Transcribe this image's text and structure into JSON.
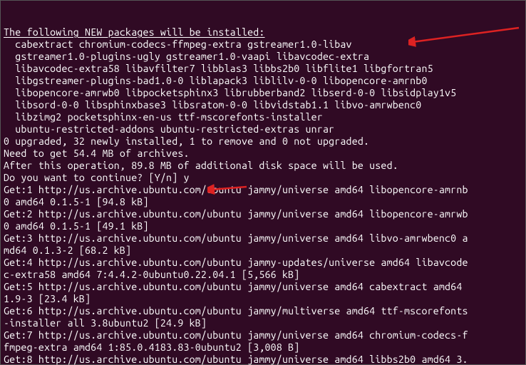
{
  "header": "The following NEW packages will be installed:",
  "packages_indent": "  ",
  "package_lines": [
    "cabextract chromium-codecs-ffmpeg-extra gstreamer1.0-libav",
    "gstreamer1.0-plugins-ugly gstreamer1.0-vaapi libavcodec-extra",
    "libavcodec-extra58 libavfilter7 libblas3 libbs2b0 libflite1 libgfortran5",
    "libgstreamer-plugins-bad1.0-0 liblapack3 liblilv-0-0 libopencore-amrnb0",
    "libopencore-amrwb0 libpocketsphinx3 librubberband2 libserd-0-0 libsidplay1v5",
    "libsord-0-0 libsphinxbase3 libsratom-0-0 libvidstab1.1 libvo-amrwbenc0",
    "libzimg2 pocketsphinx-en-us ttf-mscorefonts-installer",
    "ubuntu-restricted-addons ubuntu-restricted-extras unrar"
  ],
  "summary": [
    "0 upgraded, 32 newly installed, 1 to remove and 0 not upgraded.",
    "Need to get 54.4 MB of archives.",
    "After this operation, 89.8 MB of additional disk space will be used."
  ],
  "prompt_question": "Do you want to continue? [Y/n] ",
  "prompt_answer": "y",
  "downloads": [
    "Get:1 http://us.archive.ubuntu.com/ubuntu jammy/universe amd64 libopencore-amrnb0 amd64 0.1.5-1 [94.8 kB]",
    "Get:2 http://us.archive.ubuntu.com/ubuntu jammy/universe amd64 libopencore-amrwb0 amd64 0.1.5-1 [49.1 kB]",
    "Get:3 http://us.archive.ubuntu.com/ubuntu jammy/universe amd64 libvo-amrwbenc0 amd64 0.1.3-2 [68.2 kB]",
    "Get:4 http://us.archive.ubuntu.com/ubuntu jammy-updates/universe amd64 libavcodec-extra58 amd64 7:4.4.2-0ubuntu0.22.04.1 [5,566 kB]",
    "Get:5 http://us.archive.ubuntu.com/ubuntu jammy/universe amd64 cabextract amd64 1.9-3 [23.4 kB]",
    "Get:6 http://us.archive.ubuntu.com/ubuntu jammy/multiverse amd64 ttf-mscorefonts-installer all 3.8ubuntu2 [24.9 kB]",
    "Get:7 http://us.archive.ubuntu.com/ubuntu jammy/universe amd64 chromium-codecs-ffmpeg-extra amd64 1:85.0.4183.83-0ubuntu2 [3,008 B]",
    "Get:8 http://us.archive.ubuntu.com/ubuntu jammy/universe amd64 libbs2b0 amd64 3."
  ]
}
